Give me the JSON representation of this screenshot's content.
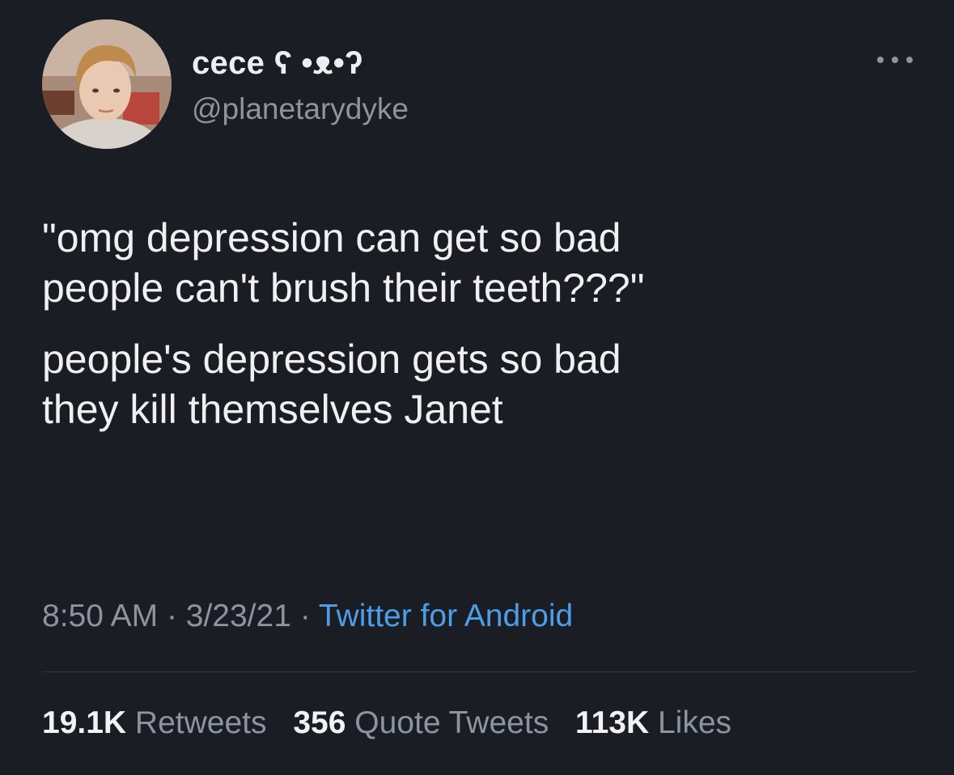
{
  "user": {
    "display_name": "cece ʕ •ᴥ•ʔ",
    "handle": "@planetarydyke"
  },
  "menu": {
    "icon": "more-horizontal-icon"
  },
  "tweet": {
    "paragraphs": [
      "\"omg depression can get so bad\npeople can't brush their teeth???\"",
      "people's depression gets so bad\nthey kill themselves Janet"
    ]
  },
  "meta": {
    "time": "8:50 AM",
    "date": "3/23/21",
    "separator": "·",
    "source": "Twitter for Android"
  },
  "stats": {
    "retweets_count": "19.1K",
    "retweets_label": "Retweets",
    "quotes_count": "356",
    "quotes_label": "Quote Tweets",
    "likes_count": "113K",
    "likes_label": "Likes"
  },
  "colors": {
    "background": "#1b1d24",
    "text": "#eef0f2",
    "muted": "#8c949c",
    "link": "#4d9ee6"
  }
}
